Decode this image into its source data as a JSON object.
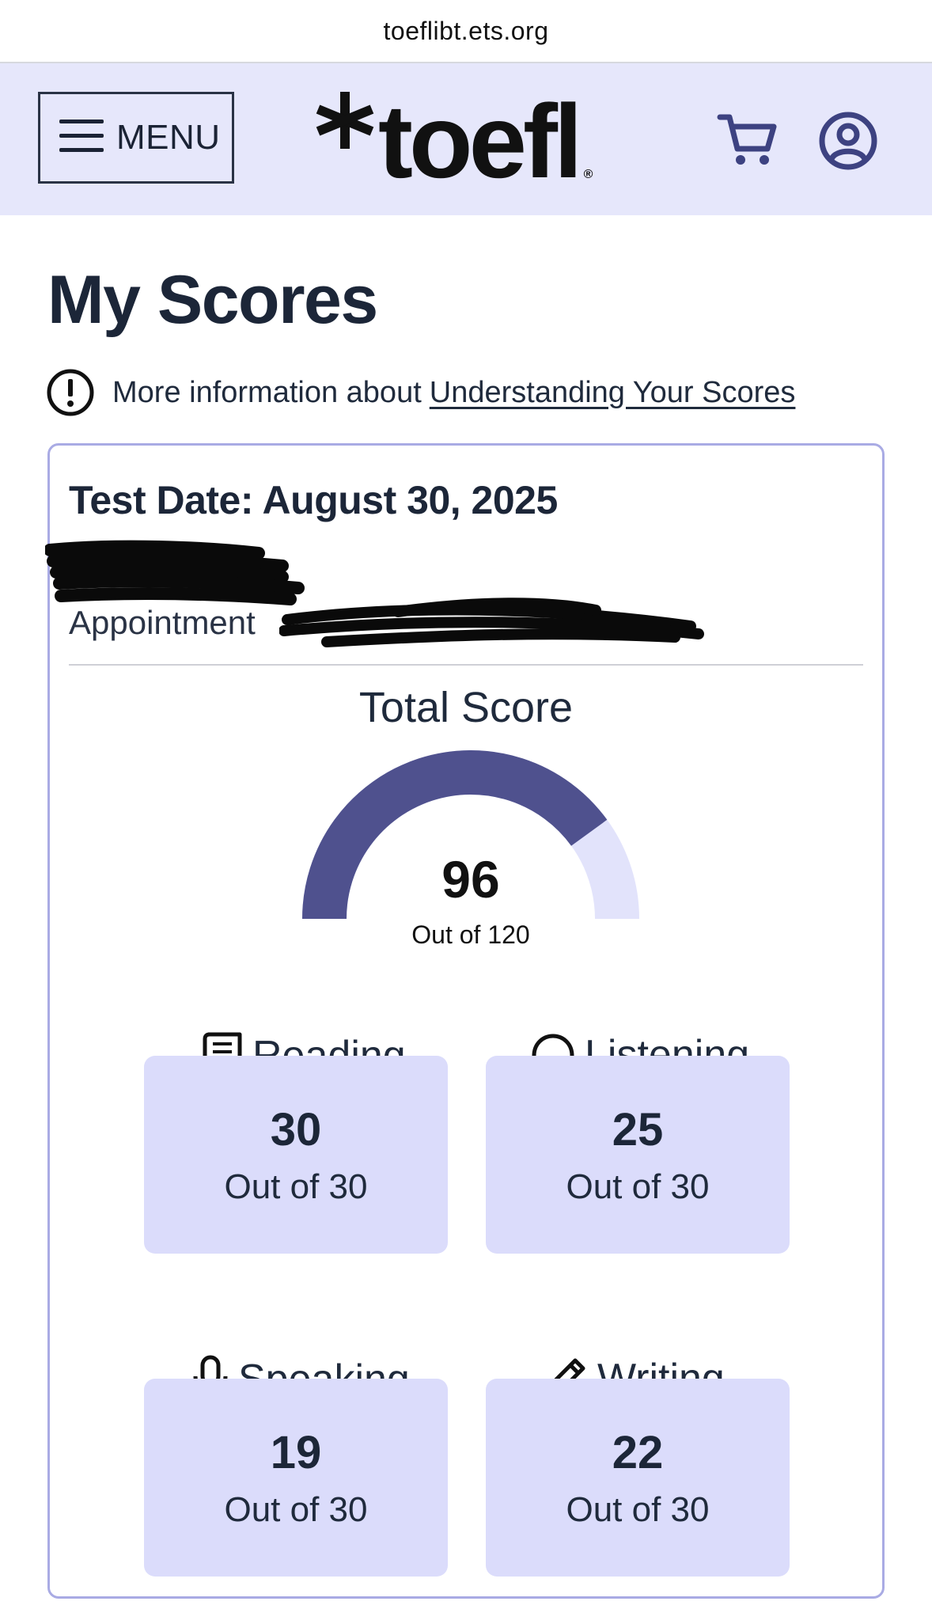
{
  "browser": {
    "url": "toeflibt.ets.org"
  },
  "header": {
    "menu_label": "MENU",
    "logo_text": "toefl",
    "logo_reg": "®",
    "icons": [
      "menu-icon",
      "asterisk-logo-icon",
      "cart-icon",
      "account-icon"
    ]
  },
  "page": {
    "title": "My Scores",
    "info_prefix": "More information about",
    "info_link": "Understanding Your Scores"
  },
  "card": {
    "test_date": "Test Date: August 30, 2025",
    "appointment_label": "Appointment"
  },
  "total": {
    "label": "Total Score",
    "score": "96",
    "out_of": "Out of 120",
    "value": 96,
    "max": 120
  },
  "sections": {
    "reading": {
      "label": "Reading",
      "score": "30",
      "out_of": "Out of 30",
      "icon": "book-icon"
    },
    "listening": {
      "label": "Listening",
      "score": "25",
      "out_of": "Out of 30",
      "icon": "headphones-icon"
    },
    "speaking": {
      "label": "Speaking",
      "score": "19",
      "out_of": "Out of 30",
      "icon": "microphone-icon"
    },
    "writing": {
      "label": "Writing",
      "score": "22",
      "out_of": "Out of 30",
      "icon": "pencil-icon"
    }
  },
  "colors": {
    "header_bg": "#e6e7fb",
    "gauge_fill": "#4f518e",
    "gauge_track": "#e2e3fb",
    "score_box": "#dbdcfb",
    "card_border": "#a9abe4",
    "text_dark": "#1c2638"
  }
}
